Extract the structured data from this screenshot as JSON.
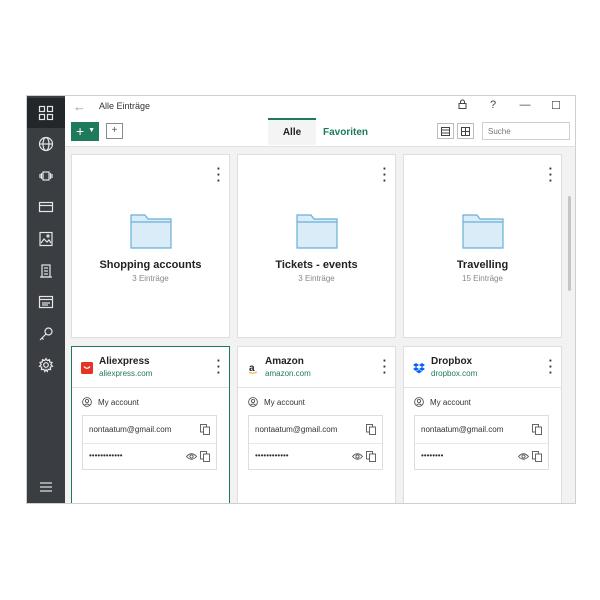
{
  "window": {
    "title": "Alle Einträge",
    "controls": {
      "lock": "🔒",
      "help": "?",
      "minimize": "—",
      "maximize": "☐",
      "close": "✕"
    }
  },
  "toolbar": {
    "add_label": "+",
    "tabs": [
      {
        "label": "Alle",
        "active": true
      },
      {
        "label": "Favoriten",
        "active": false
      }
    ],
    "search_placeholder": "Suche"
  },
  "sidebar": {
    "items": [
      {
        "icon": "dashboard-icon",
        "active": true
      },
      {
        "icon": "globe-icon",
        "active": false
      },
      {
        "icon": "apps-icon",
        "active": false
      },
      {
        "icon": "credit-card-icon",
        "active": false
      },
      {
        "icon": "image-icon",
        "active": false
      },
      {
        "icon": "building-icon",
        "active": false
      },
      {
        "icon": "id-card-icon",
        "active": false
      },
      {
        "icon": "key-icon",
        "active": false
      },
      {
        "icon": "settings-icon",
        "active": false
      }
    ],
    "menu_icon": "hamburger-icon"
  },
  "folders": [
    {
      "name": "Shopping accounts",
      "count": "3 Einträge"
    },
    {
      "name": "Tickets - events",
      "count": "3 Einträge"
    },
    {
      "name": "Travelling",
      "count": "15 Einträge"
    }
  ],
  "entries": [
    {
      "name": "Aliexpress",
      "url": "aliexpress.com",
      "account": "My account",
      "login": "nontaatum@gmail.com",
      "password": "••••••••••••",
      "brand_color": "#e43225"
    },
    {
      "name": "Amazon",
      "url": "amazon.com",
      "account": "My account",
      "login": "nontaatum@gmail.com",
      "password": "••••••••••••",
      "brand_color": "#222222"
    },
    {
      "name": "Dropbox",
      "url": "dropbox.com",
      "account": "My account",
      "login": "nontaatum@gmail.com",
      "password": "••••••••",
      "brand_color": "#0061fe"
    }
  ],
  "colors": {
    "accent": "#1e7a5a",
    "sidebar": "#3a3d42",
    "folder": "#a9d4ee"
  }
}
